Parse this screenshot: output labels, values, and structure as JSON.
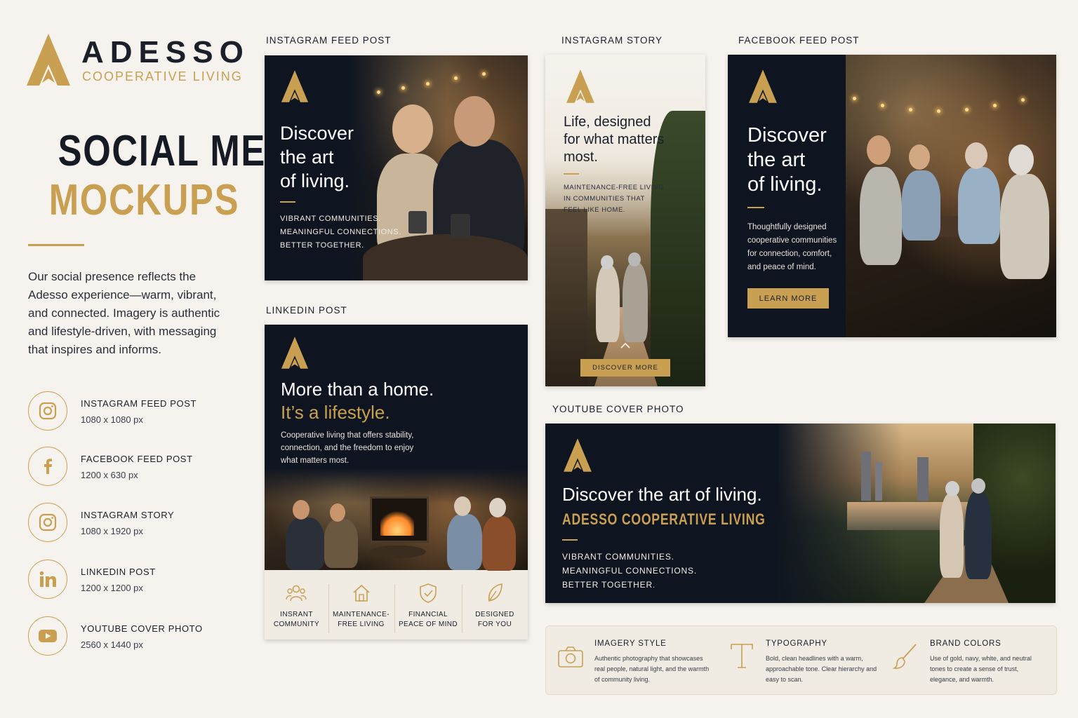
{
  "brand": {
    "name": "ADESSO",
    "tagline": "COOPERATIVE LIVING"
  },
  "page": {
    "title_line1": "SOCIAL MEDIA",
    "title_line2": "MOCKUPS",
    "intro": "Our social presence reflects the Adesso experience—warm, vibrant, and connected. Imagery is authentic and lifestyle-driven, with messaging that inspires and informs."
  },
  "specs": [
    {
      "name": "INSTAGRAM FEED POST",
      "size": "1080 x 1080 px",
      "icon": "instagram-icon"
    },
    {
      "name": "FACEBOOK FEED POST",
      "size": "1200 x 630 px",
      "icon": "facebook-icon"
    },
    {
      "name": "INSTAGRAM STORY",
      "size": "1080 x 1920 px",
      "icon": "instagram-icon"
    },
    {
      "name": "LINKEDIN POST",
      "size": "1200 x 1200 px",
      "icon": "linkedin-icon"
    },
    {
      "name": "YOUTUBE COVER PHOTO",
      "size": "2560 x 1440 px",
      "icon": "youtube-icon"
    }
  ],
  "instagram_feed": {
    "label": "INSTAGRAM FEED POST",
    "headline": [
      "Discover",
      "the art",
      "of living."
    ],
    "lines": [
      "VIBRANT COMMUNITIES.",
      "MEANINGFUL CONNECTIONS.",
      "BETTER TOGETHER."
    ]
  },
  "instagram_story": {
    "label": "INSTAGRAM STORY",
    "headline": [
      "Life, designed",
      "for what matters",
      "most."
    ],
    "lines": [
      "MAINTENANCE-FREE LIVING",
      "IN COMMUNITIES THAT",
      "FEEL LIKE HOME."
    ],
    "button": "DISCOVER MORE"
  },
  "facebook_feed": {
    "label": "FACEBOOK FEED POST",
    "headline": [
      "Discover",
      "the art",
      "of living."
    ],
    "body": [
      "Thoughtfully designed",
      "cooperative communities",
      "for connection, comfort,",
      "and peace of mind."
    ],
    "button": "LEARN MORE"
  },
  "linkedin": {
    "label": "LINKEDIN POST",
    "headline1": "More than a home.",
    "headline2": "It’s a lifestyle.",
    "body": [
      "Cooperative living that offers stability,",
      "connection, and the freedom to enjoy",
      "what matters most."
    ],
    "features": [
      {
        "line1": "INSRANT",
        "line2": "COMMUNITY",
        "icon": "people-icon"
      },
      {
        "line1": "MAINTENANCE-",
        "line2": "FREE LIVING",
        "icon": "house-icon"
      },
      {
        "line1": "FINANCIAL",
        "line2": "PEACE OF MIND",
        "icon": "shield-icon"
      },
      {
        "line1": "DESIGNED",
        "line2": "FOR YOU",
        "icon": "leaf-icon"
      }
    ]
  },
  "youtube": {
    "label": "YOUTUBE COVER PHOTO",
    "headline": "Discover the art of living.",
    "subhead": "ADESSO COOPERATIVE LIVING",
    "lines": [
      "VIBRANT COMMUNITIES.",
      "MEANINGFUL CONNECTIONS.",
      "BETTER TOGETHER."
    ]
  },
  "guidelines": [
    {
      "title": "IMAGERY STYLE",
      "text": "Authentic photography that showcases real people, natural light, and the warmth of community living.",
      "icon": "camera-icon"
    },
    {
      "title": "TYPOGRAPHY",
      "text": "Bold, clean headlines with a warm, approachable tone. Clear hierarchy and easy to scan.",
      "icon": "typography-icon"
    },
    {
      "title": "BRAND COLORS",
      "text": "Use of gold, navy, white, and neutral tones to create a sense of trust, elegance, and warmth.",
      "icon": "brush-icon"
    }
  ],
  "colors": {
    "gold": "#c9a052",
    "navy": "#0f1520",
    "background": "#f6f3ee"
  }
}
